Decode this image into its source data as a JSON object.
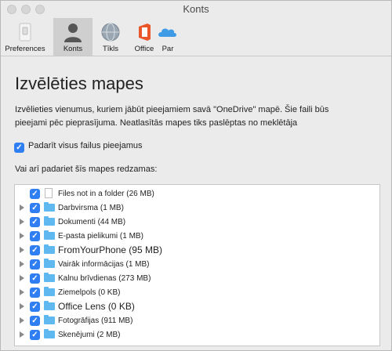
{
  "window": {
    "title": "Konts"
  },
  "toolbar": {
    "items": [
      {
        "label": "Preferences",
        "icon": "preferences-switch-icon"
      },
      {
        "label": "Konts",
        "icon": "account-person-icon",
        "active": true
      },
      {
        "label": "Tīkls",
        "icon": "network-globe-icon"
      },
      {
        "label": "Office",
        "icon": "office-logo-icon"
      },
      {
        "label": "Par",
        "icon": "onedrive-cloud-icon"
      }
    ]
  },
  "main": {
    "heading": "Izvēlēties mapes",
    "description_line1": "Izvēlieties vienumus, kuriem jābūt pieejamiem savā \"OneDrive\" mapē. Šie faili būs",
    "description_line2": "pieejami pēc pieprasījuma. Neatlasītās mapes tiks paslēptas no meklētāja",
    "make_all_label": "Padarīt visus failus pieejamus",
    "make_all_checked": true,
    "or_show_label": "Vai arī padariet šīs mapes redzamas:",
    "items": [
      {
        "name": "Files not in a folder (26 MB)",
        "type": "file",
        "checked": true
      },
      {
        "name": "Darbvirsma (1 MB)",
        "type": "folder",
        "checked": true
      },
      {
        "name": "Dokumenti (44 MB)",
        "type": "folder",
        "checked": true
      },
      {
        "name": "E-pasta pielikumi (1 MB)",
        "type": "folder",
        "checked": true
      },
      {
        "name": "FromYourPhone  (95 MB)",
        "type": "folder",
        "checked": true,
        "emphasis": true
      },
      {
        "name": "Vairāk informācijas (1 MB)",
        "type": "folder",
        "checked": true
      },
      {
        "name": "Kalnu brīvdienas (273 MB)",
        "type": "folder",
        "checked": true
      },
      {
        "name": "Ziemelpols (0 KB)",
        "type": "folder",
        "checked": true
      },
      {
        "name": "Office Lens (0 KB)",
        "type": "folder",
        "checked": true
      },
      {
        "name": "Fotogrāfijas (911 MB)",
        "type": "folder",
        "checked": true
      },
      {
        "name": "Skenējumi (2 MB)",
        "type": "folder",
        "checked": true
      }
    ]
  },
  "colors": {
    "checkbox": "#2f7ef2",
    "folder": "#5fb9f0",
    "window_bg": "#ebebeb",
    "active_tab": "#cfcfcf"
  }
}
